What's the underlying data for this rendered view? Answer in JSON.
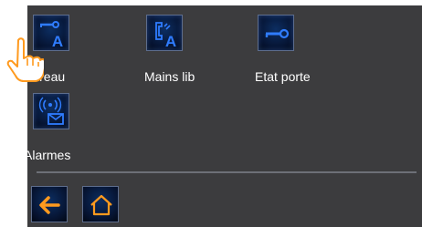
{
  "tiles": [
    {
      "label": "Bureau",
      "icon": "key-a-icon"
    },
    {
      "label": "Mains lib",
      "icon": "handset-a-icon"
    },
    {
      "label": "Etat porte",
      "icon": "key-icon"
    },
    {
      "label": "Alarmes",
      "icon": "alarm-mail-icon"
    }
  ],
  "nav": {
    "back": {
      "icon": "back-arrow-icon"
    },
    "home": {
      "icon": "home-icon"
    }
  },
  "colors": {
    "background": "#3c3c3e",
    "icon_blue": "#2f7cff",
    "nav_orange": "#ff9a1e",
    "label": "#ffffff"
  }
}
